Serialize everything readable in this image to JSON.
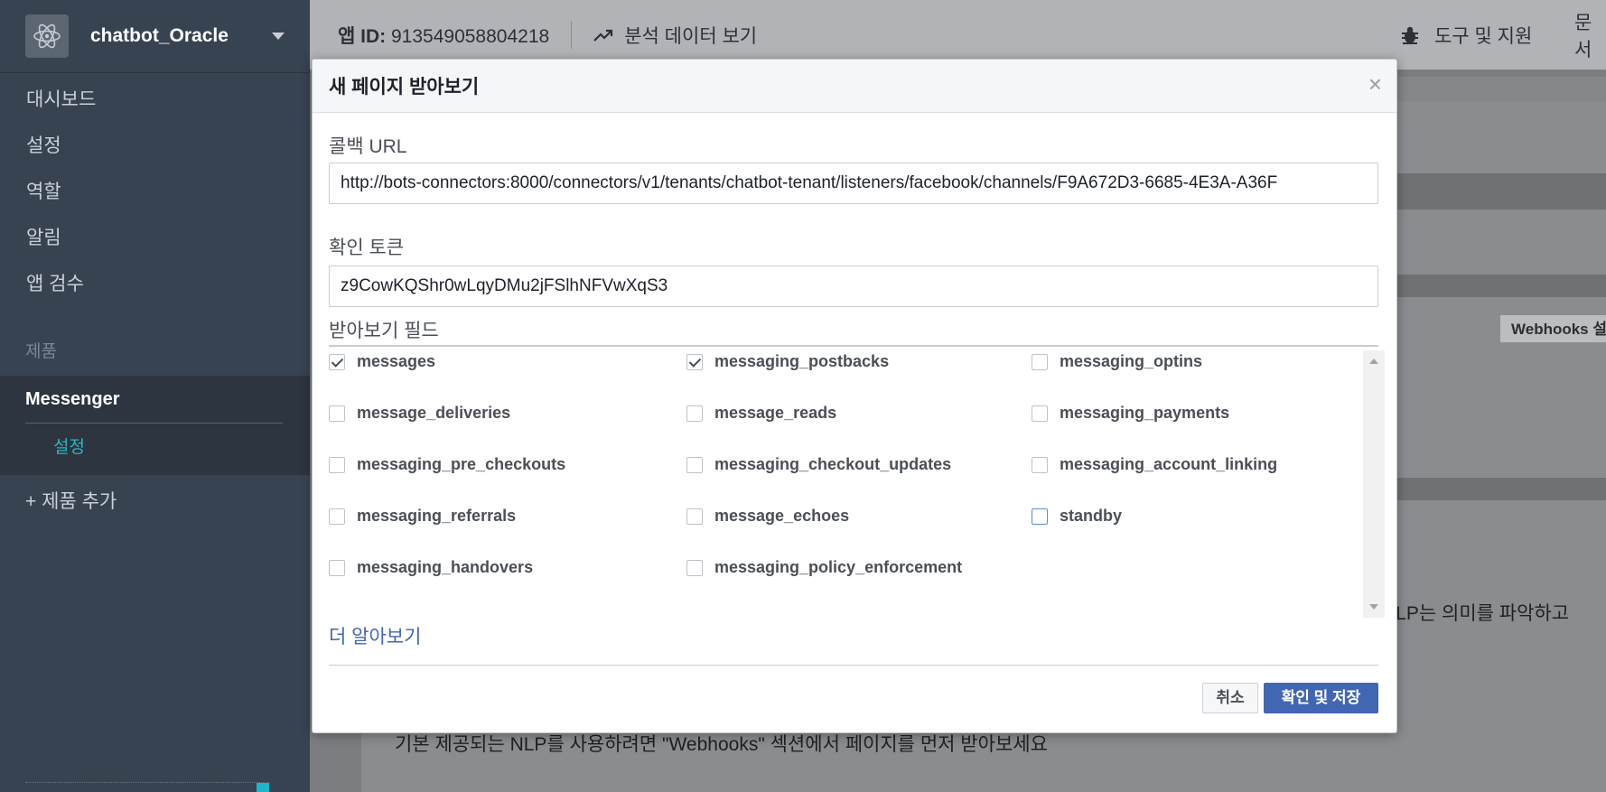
{
  "sidebar": {
    "app_name": "chatbot_Oracle",
    "nav": [
      "대시보드",
      "설정",
      "역할",
      "알림",
      "앱 검수"
    ],
    "section_label": "제품",
    "product": "Messenger",
    "product_sub": "설정",
    "add_product": "+ 제품 추가"
  },
  "topbar": {
    "app_id_label": "앱 ID:",
    "app_id_value": "913549058804218",
    "analytics": "분석 데이터 보기",
    "tools": "도구 및 지원",
    "docs": "문서"
  },
  "background": {
    "webhooks_button": "Webhooks 설정",
    "nlp_text": "NLP는 의미를 파악하고",
    "bottom_text": "기본 제공되는 NLP를 사용하려면 \"Webhooks\" 섹션에서 페이지를 먼저 받아보세요"
  },
  "modal": {
    "title": "새 페이지 받아보기",
    "close": "×",
    "callback_label": "콜백 URL",
    "callback_value": "http://bots-connectors:8000/connectors/v1/tenants/chatbot-tenant/listeners/facebook/channels/F9A672D3-6685-4E3A-A36F",
    "token_label": "확인 토큰",
    "token_value": "z9CowKQShr0wLqyDMu2jFSlhNFVwXqS3",
    "fields_label": "받아보기 필드",
    "fields": [
      {
        "name": "messages",
        "checked": true
      },
      {
        "name": "messaging_postbacks",
        "checked": true
      },
      {
        "name": "messaging_optins",
        "checked": false
      },
      {
        "name": "message_deliveries",
        "checked": false
      },
      {
        "name": "message_reads",
        "checked": false
      },
      {
        "name": "messaging_payments",
        "checked": false
      },
      {
        "name": "messaging_pre_checkouts",
        "checked": false
      },
      {
        "name": "messaging_checkout_updates",
        "checked": false
      },
      {
        "name": "messaging_account_linking",
        "checked": false
      },
      {
        "name": "messaging_referrals",
        "checked": false
      },
      {
        "name": "message_echoes",
        "checked": false
      },
      {
        "name": "standby",
        "checked": false
      },
      {
        "name": "messaging_handovers",
        "checked": false
      },
      {
        "name": "messaging_policy_enforcement",
        "checked": false
      }
    ],
    "learn_more": "더 알아보기",
    "cancel": "취소",
    "save": "확인 및 저장"
  }
}
